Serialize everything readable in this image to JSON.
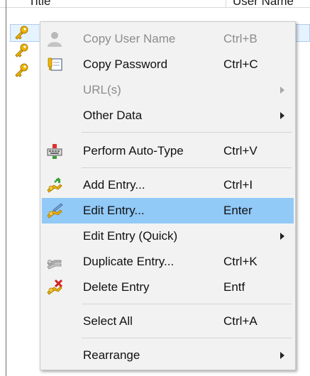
{
  "listview": {
    "columns": [
      {
        "label": "Title"
      },
      {
        "label": "User Name"
      }
    ]
  },
  "context_menu": {
    "items": [
      {
        "label": "Copy User Name",
        "shortcut": "Ctrl+B",
        "icon": "user-icon",
        "disabled": true
      },
      {
        "label": "Copy Password",
        "shortcut": "Ctrl+C",
        "icon": "key-card-icon",
        "disabled": false
      },
      {
        "label": "URL(s)",
        "shortcut": "",
        "icon": "",
        "disabled": true,
        "submenu": true
      },
      {
        "label": "Other Data",
        "shortcut": "",
        "icon": "",
        "disabled": false,
        "submenu": true
      },
      {
        "label": "Perform Auto-Type",
        "shortcut": "Ctrl+V",
        "icon": "auto-type-icon",
        "disabled": false
      },
      {
        "label": "Add Entry...",
        "shortcut": "Ctrl+I",
        "icon": "add-key-icon",
        "disabled": false
      },
      {
        "label": "Edit Entry...",
        "shortcut": "Enter",
        "icon": "edit-key-icon",
        "disabled": false,
        "highlighted": true
      },
      {
        "label": "Edit Entry (Quick)",
        "shortcut": "",
        "icon": "",
        "disabled": false,
        "submenu": true
      },
      {
        "label": "Duplicate Entry...",
        "shortcut": "Ctrl+K",
        "icon": "duplicate-key-icon",
        "disabled": false
      },
      {
        "label": "Delete Entry",
        "shortcut": "Entf",
        "icon": "delete-key-icon",
        "disabled": false
      },
      {
        "label": "Select All",
        "shortcut": "Ctrl+A",
        "icon": "",
        "disabled": false
      },
      {
        "label": "Rearrange",
        "shortcut": "",
        "icon": "",
        "disabled": false,
        "submenu": true
      }
    ]
  },
  "colors": {
    "menu_background": "#f2f2f2",
    "highlight": "#91c9f7",
    "disabled_text": "#8c8c8c",
    "key_gold": "#f0b400"
  }
}
